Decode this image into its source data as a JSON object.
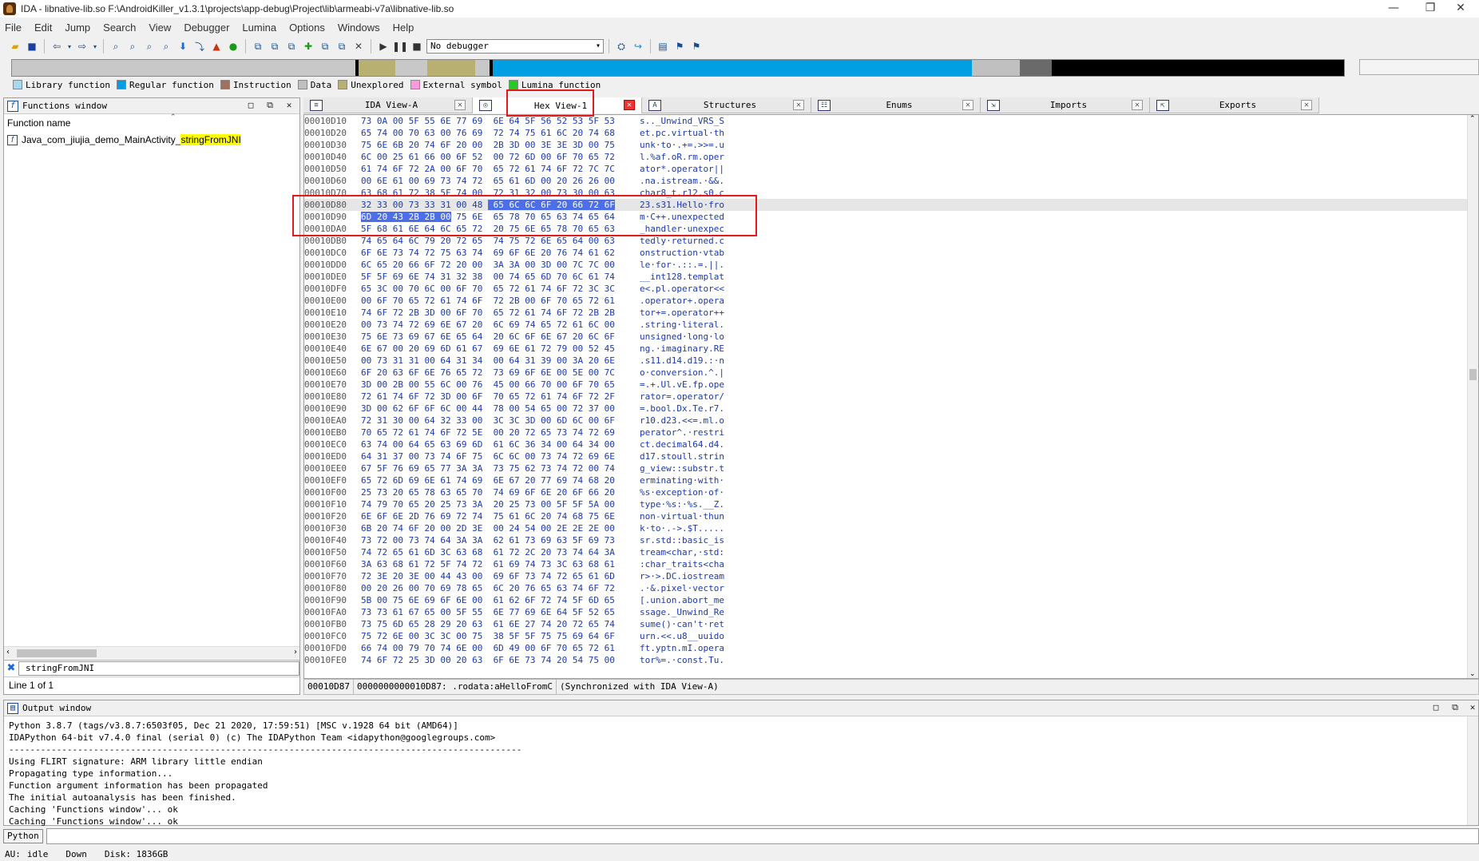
{
  "window": {
    "title": "IDA - libnative-lib.so F:\\AndroidKiller_v1.3.1\\projects\\app-debug\\Project\\lib\\armeabi-v7a\\libnative-lib.so",
    "controls": [
      "—",
      "❐",
      "✕"
    ]
  },
  "menu": [
    "File",
    "Edit",
    "Jump",
    "Search",
    "View",
    "Debugger",
    "Lumina",
    "Options",
    "Windows",
    "Help"
  ],
  "toolbar": {
    "debugger_selected": "No debugger"
  },
  "legend": [
    {
      "label": "Library function",
      "color": "#a6d8f0"
    },
    {
      "label": "Regular function",
      "color": "#009fe3"
    },
    {
      "label": "Instruction",
      "color": "#a0705a"
    },
    {
      "label": "Data",
      "color": "#c0c0c0"
    },
    {
      "label": "Unexplored",
      "color": "#b8b070"
    },
    {
      "label": "External symbol",
      "color": "#ff99dd"
    },
    {
      "label": "Lumina function",
      "color": "#22cc22"
    }
  ],
  "functions_window": {
    "title": "Functions window",
    "column": "Function name",
    "rows": [
      {
        "prefix": "Java_com_jiujia_demo_MainActivity_",
        "highlight": "stringFromJNI"
      }
    ],
    "search_value": "stringFromJNI",
    "status": "Line 1 of 1"
  },
  "tabs": [
    {
      "label": "IDA View-A",
      "icon": "listing-icon",
      "active": false
    },
    {
      "label": "Hex View-1",
      "icon": "hex-icon",
      "active": true
    },
    {
      "label": "Structures",
      "icon": "structures-icon",
      "active": false
    },
    {
      "label": "Enums",
      "icon": "enums-icon",
      "active": false
    },
    {
      "label": "Imports",
      "icon": "imports-icon",
      "active": false
    },
    {
      "label": "Exports",
      "icon": "exports-icon",
      "active": false
    }
  ],
  "hex_lines": [
    {
      "addr": "00010D10",
      "bytes": "73 0A 00 5F 55 6E 77 69  6E 64 5F 56 52 53 5F 53",
      "ascii": "s.._Unwind_VRS_S"
    },
    {
      "addr": "00010D20",
      "bytes": "65 74 00 70 63 00 76 69  72 74 75 61 6C 20 74 68",
      "ascii": "et.pc.virtual·th"
    },
    {
      "addr": "00010D30",
      "bytes": "75 6E 6B 20 74 6F 20 00  2B 3D 00 3E 3E 3D 00 75",
      "ascii": "unk·to·.+=.>>=.u"
    },
    {
      "addr": "00010D40",
      "bytes": "6C 00 25 61 66 00 6F 52  00 72 6D 00 6F 70 65 72",
      "ascii": "l.%af.oR.rm.oper"
    },
    {
      "addr": "00010D50",
      "bytes": "61 74 6F 72 2A 00 6F 70  65 72 61 74 6F 72 7C 7C",
      "ascii": "ator*.operator||"
    },
    {
      "addr": "00010D60",
      "bytes": "00 6E 61 00 69 73 74 72  65 61 6D 00 20 26 26 00",
      "ascii": ".na.istream.·&&."
    },
    {
      "addr": "00010D70",
      "bytes": "63 68 61 72 38 5F 74 00  72 31 32 00 73 30 00 63",
      "ascii": "char8_t.r12.s0.c"
    },
    {
      "addr": "00010D80",
      "bytes": "32 33 00 73 33 31 00 48  65 6C 6C 6F 20 66 72 6F",
      "ascii": "23.s31.Hello·fro",
      "cur": true
    },
    {
      "addr": "00010D90",
      "bytes": "6D 20 43 2B 2B 00 75 6E  65 78 70 65 63 74 65 64",
      "ascii": "m·C++.unexpected"
    },
    {
      "addr": "00010DA0",
      "bytes": "5F 68 61 6E 64 6C 65 72  20 75 6E 65 78 70 65 63",
      "ascii": "_handler·unexpec"
    },
    {
      "addr": "00010DB0",
      "bytes": "74 65 64 6C 79 20 72 65  74 75 72 6E 65 64 00 63",
      "ascii": "tedly·returned.c"
    },
    {
      "addr": "00010DC0",
      "bytes": "6F 6E 73 74 72 75 63 74  69 6F 6E 20 76 74 61 62",
      "ascii": "onstruction·vtab"
    },
    {
      "addr": "00010DD0",
      "bytes": "6C 65 20 66 6F 72 20 00  3A 3A 00 3D 00 7C 7C 00",
      "ascii": "le·for·.::.=.||."
    },
    {
      "addr": "00010DE0",
      "bytes": "5F 5F 69 6E 74 31 32 38  00 74 65 6D 70 6C 61 74",
      "ascii": "__int128.templat"
    },
    {
      "addr": "00010DF0",
      "bytes": "65 3C 00 70 6C 00 6F 70  65 72 61 74 6F 72 3C 3C",
      "ascii": "e<.pl.operator<<"
    },
    {
      "addr": "00010E00",
      "bytes": "00 6F 70 65 72 61 74 6F  72 2B 00 6F 70 65 72 61",
      "ascii": ".operator+.opera"
    },
    {
      "addr": "00010E10",
      "bytes": "74 6F 72 2B 3D 00 6F 70  65 72 61 74 6F 72 2B 2B",
      "ascii": "tor+=.operator++"
    },
    {
      "addr": "00010E20",
      "bytes": "00 73 74 72 69 6E 67 20  6C 69 74 65 72 61 6C 00",
      "ascii": ".string·literal."
    },
    {
      "addr": "00010E30",
      "bytes": "75 6E 73 69 67 6E 65 64  20 6C 6F 6E 67 20 6C 6F",
      "ascii": "unsigned·long·lo"
    },
    {
      "addr": "00010E40",
      "bytes": "6E 67 00 20 69 6D 61 67  69 6E 61 72 79 00 52 45",
      "ascii": "ng.·imaginary.RE"
    },
    {
      "addr": "00010E50",
      "bytes": "00 73 31 31 00 64 31 34  00 64 31 39 00 3A 20 6E",
      "ascii": ".s11.d14.d19.:·n"
    },
    {
      "addr": "00010E60",
      "bytes": "6F 20 63 6F 6E 76 65 72  73 69 6F 6E 00 5E 00 7C",
      "ascii": "o·conversion.^.|"
    },
    {
      "addr": "00010E70",
      "bytes": "3D 00 2B 00 55 6C 00 76  45 00 66 70 00 6F 70 65",
      "ascii": "=.+.Ul.vE.fp.ope"
    },
    {
      "addr": "00010E80",
      "bytes": "72 61 74 6F 72 3D 00 6F  70 65 72 61 74 6F 72 2F",
      "ascii": "rator=.operator/"
    },
    {
      "addr": "00010E90",
      "bytes": "3D 00 62 6F 6F 6C 00 44  78 00 54 65 00 72 37 00",
      "ascii": "=.bool.Dx.Te.r7."
    },
    {
      "addr": "00010EA0",
      "bytes": "72 31 30 00 64 32 33 00  3C 3C 3D 00 6D 6C 00 6F",
      "ascii": "r10.d23.<<=.ml.o"
    },
    {
      "addr": "00010EB0",
      "bytes": "70 65 72 61 74 6F 72 5E  00 20 72 65 73 74 72 69",
      "ascii": "perator^.·restri"
    },
    {
      "addr": "00010EC0",
      "bytes": "63 74 00 64 65 63 69 6D  61 6C 36 34 00 64 34 00",
      "ascii": "ct.decimal64.d4."
    },
    {
      "addr": "00010ED0",
      "bytes": "64 31 37 00 73 74 6F 75  6C 6C 00 73 74 72 69 6E",
      "ascii": "d17.stoull.strin"
    },
    {
      "addr": "00010EE0",
      "bytes": "67 5F 76 69 65 77 3A 3A  73 75 62 73 74 72 00 74",
      "ascii": "g_view::substr.t"
    },
    {
      "addr": "00010EF0",
      "bytes": "65 72 6D 69 6E 61 74 69  6E 67 20 77 69 74 68 20",
      "ascii": "erminating·with·"
    },
    {
      "addr": "00010F00",
      "bytes": "25 73 20 65 78 63 65 70  74 69 6F 6E 20 6F 66 20",
      "ascii": "%s·exception·of·"
    },
    {
      "addr": "00010F10",
      "bytes": "74 79 70 65 20 25 73 3A  20 25 73 00 5F 5F 5A 00",
      "ascii": "type·%s:·%s.__Z."
    },
    {
      "addr": "00010F20",
      "bytes": "6E 6F 6E 2D 76 69 72 74  75 61 6C 20 74 68 75 6E",
      "ascii": "non-virtual·thun"
    },
    {
      "addr": "00010F30",
      "bytes": "6B 20 74 6F 20 00 2D 3E  00 24 54 00 2E 2E 2E 00",
      "ascii": "k·to·.->.$T....."
    },
    {
      "addr": "00010F40",
      "bytes": "73 72 00 73 74 64 3A 3A  62 61 73 69 63 5F 69 73",
      "ascii": "sr.std::basic_is"
    },
    {
      "addr": "00010F50",
      "bytes": "74 72 65 61 6D 3C 63 68  61 72 2C 20 73 74 64 3A",
      "ascii": "tream<char,·std:"
    },
    {
      "addr": "00010F60",
      "bytes": "3A 63 68 61 72 5F 74 72  61 69 74 73 3C 63 68 61",
      "ascii": ":char_traits<cha"
    },
    {
      "addr": "00010F70",
      "bytes": "72 3E 20 3E 00 44 43 00  69 6F 73 74 72 65 61 6D",
      "ascii": "r>·>.DC.iostream"
    },
    {
      "addr": "00010F80",
      "bytes": "00 20 26 00 70 69 78 65  6C 20 76 65 63 74 6F 72",
      "ascii": ".·&.pixel·vector"
    },
    {
      "addr": "00010F90",
      "bytes": "5B 00 75 6E 69 6F 6E 00  61 62 6F 72 74 5F 6D 65",
      "ascii": "[.union.abort_me"
    },
    {
      "addr": "00010FA0",
      "bytes": "73 73 61 67 65 00 5F 55  6E 77 69 6E 64 5F 52 65",
      "ascii": "ssage._Unwind_Re"
    },
    {
      "addr": "00010FB0",
      "bytes": "73 75 6D 65 28 29 20 63  61 6E 27 74 20 72 65 74",
      "ascii": "sume()·can't·ret"
    },
    {
      "addr": "00010FC0",
      "bytes": "75 72 6E 00 3C 3C 00 75  38 5F 5F 75 75 69 64 6F",
      "ascii": "urn.<<.u8__uuido"
    },
    {
      "addr": "00010FD0",
      "bytes": "66 74 00 79 70 74 6E 00  6D 49 00 6F 70 65 72 61",
      "ascii": "ft.yptn.mI.opera"
    },
    {
      "addr": "00010FE0",
      "bytes": "74 6F 72 25 3D 00 20 63  6F 6E 73 74 20 54 75 00",
      "ascii": "tor%=.·const.Tu."
    }
  ],
  "hex_status": [
    "00010D87",
    "0000000000010D87: .rodata:aHelloFromC",
    "(Synchronized with IDA View-A)"
  ],
  "output_window": {
    "title": "Output window",
    "lines": [
      "Python 3.8.7 (tags/v3.8.7:6503f05, Dec 21 2020, 17:59:51) [MSC v.1928 64 bit (AMD64)]",
      "IDAPython 64-bit v7.4.0 final (serial 0) (c) The IDAPython Team <idapython@googlegroups.com>",
      "-------------------------------------------------------------------------------------------------",
      "Using FLIRT signature: ARM library little endian",
      "Propagating type information...",
      "Function argument information has been propagated",
      "The initial autoanalysis has been finished.",
      "Caching 'Functions window'... ok",
      "Caching 'Functions window'... ok"
    ]
  },
  "command_line": {
    "language": "Python"
  },
  "statusbar": {
    "au": "AU:",
    "state": "idle",
    "direction": "Down",
    "disk": "Disk: 1836GB"
  }
}
